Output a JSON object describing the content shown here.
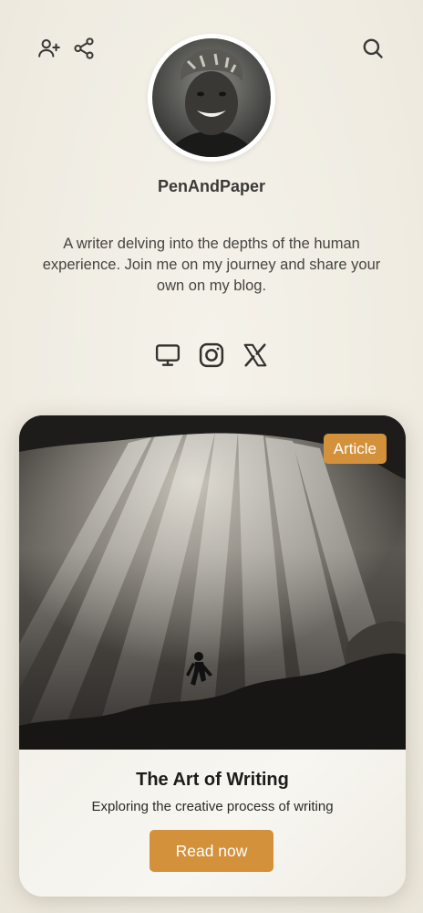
{
  "header": {
    "add_friend_icon": "user-plus-icon",
    "share_icon": "share-icon",
    "search_icon": "search-icon"
  },
  "profile": {
    "username": "PenAndPaper",
    "bio": "A writer delving into the depths of the human experience. Join me on my journey and share your own on my blog."
  },
  "socials": [
    {
      "icon": "monitor-icon"
    },
    {
      "icon": "instagram-icon"
    },
    {
      "icon": "x-icon"
    }
  ],
  "card": {
    "badge": "Article",
    "title": "The Art of Writing",
    "subtitle": "Exploring the creative process of writing",
    "button_label": "Read now"
  },
  "colors": {
    "background": "#f2efe6",
    "accent": "#d3913b",
    "text": "#3a3936"
  }
}
